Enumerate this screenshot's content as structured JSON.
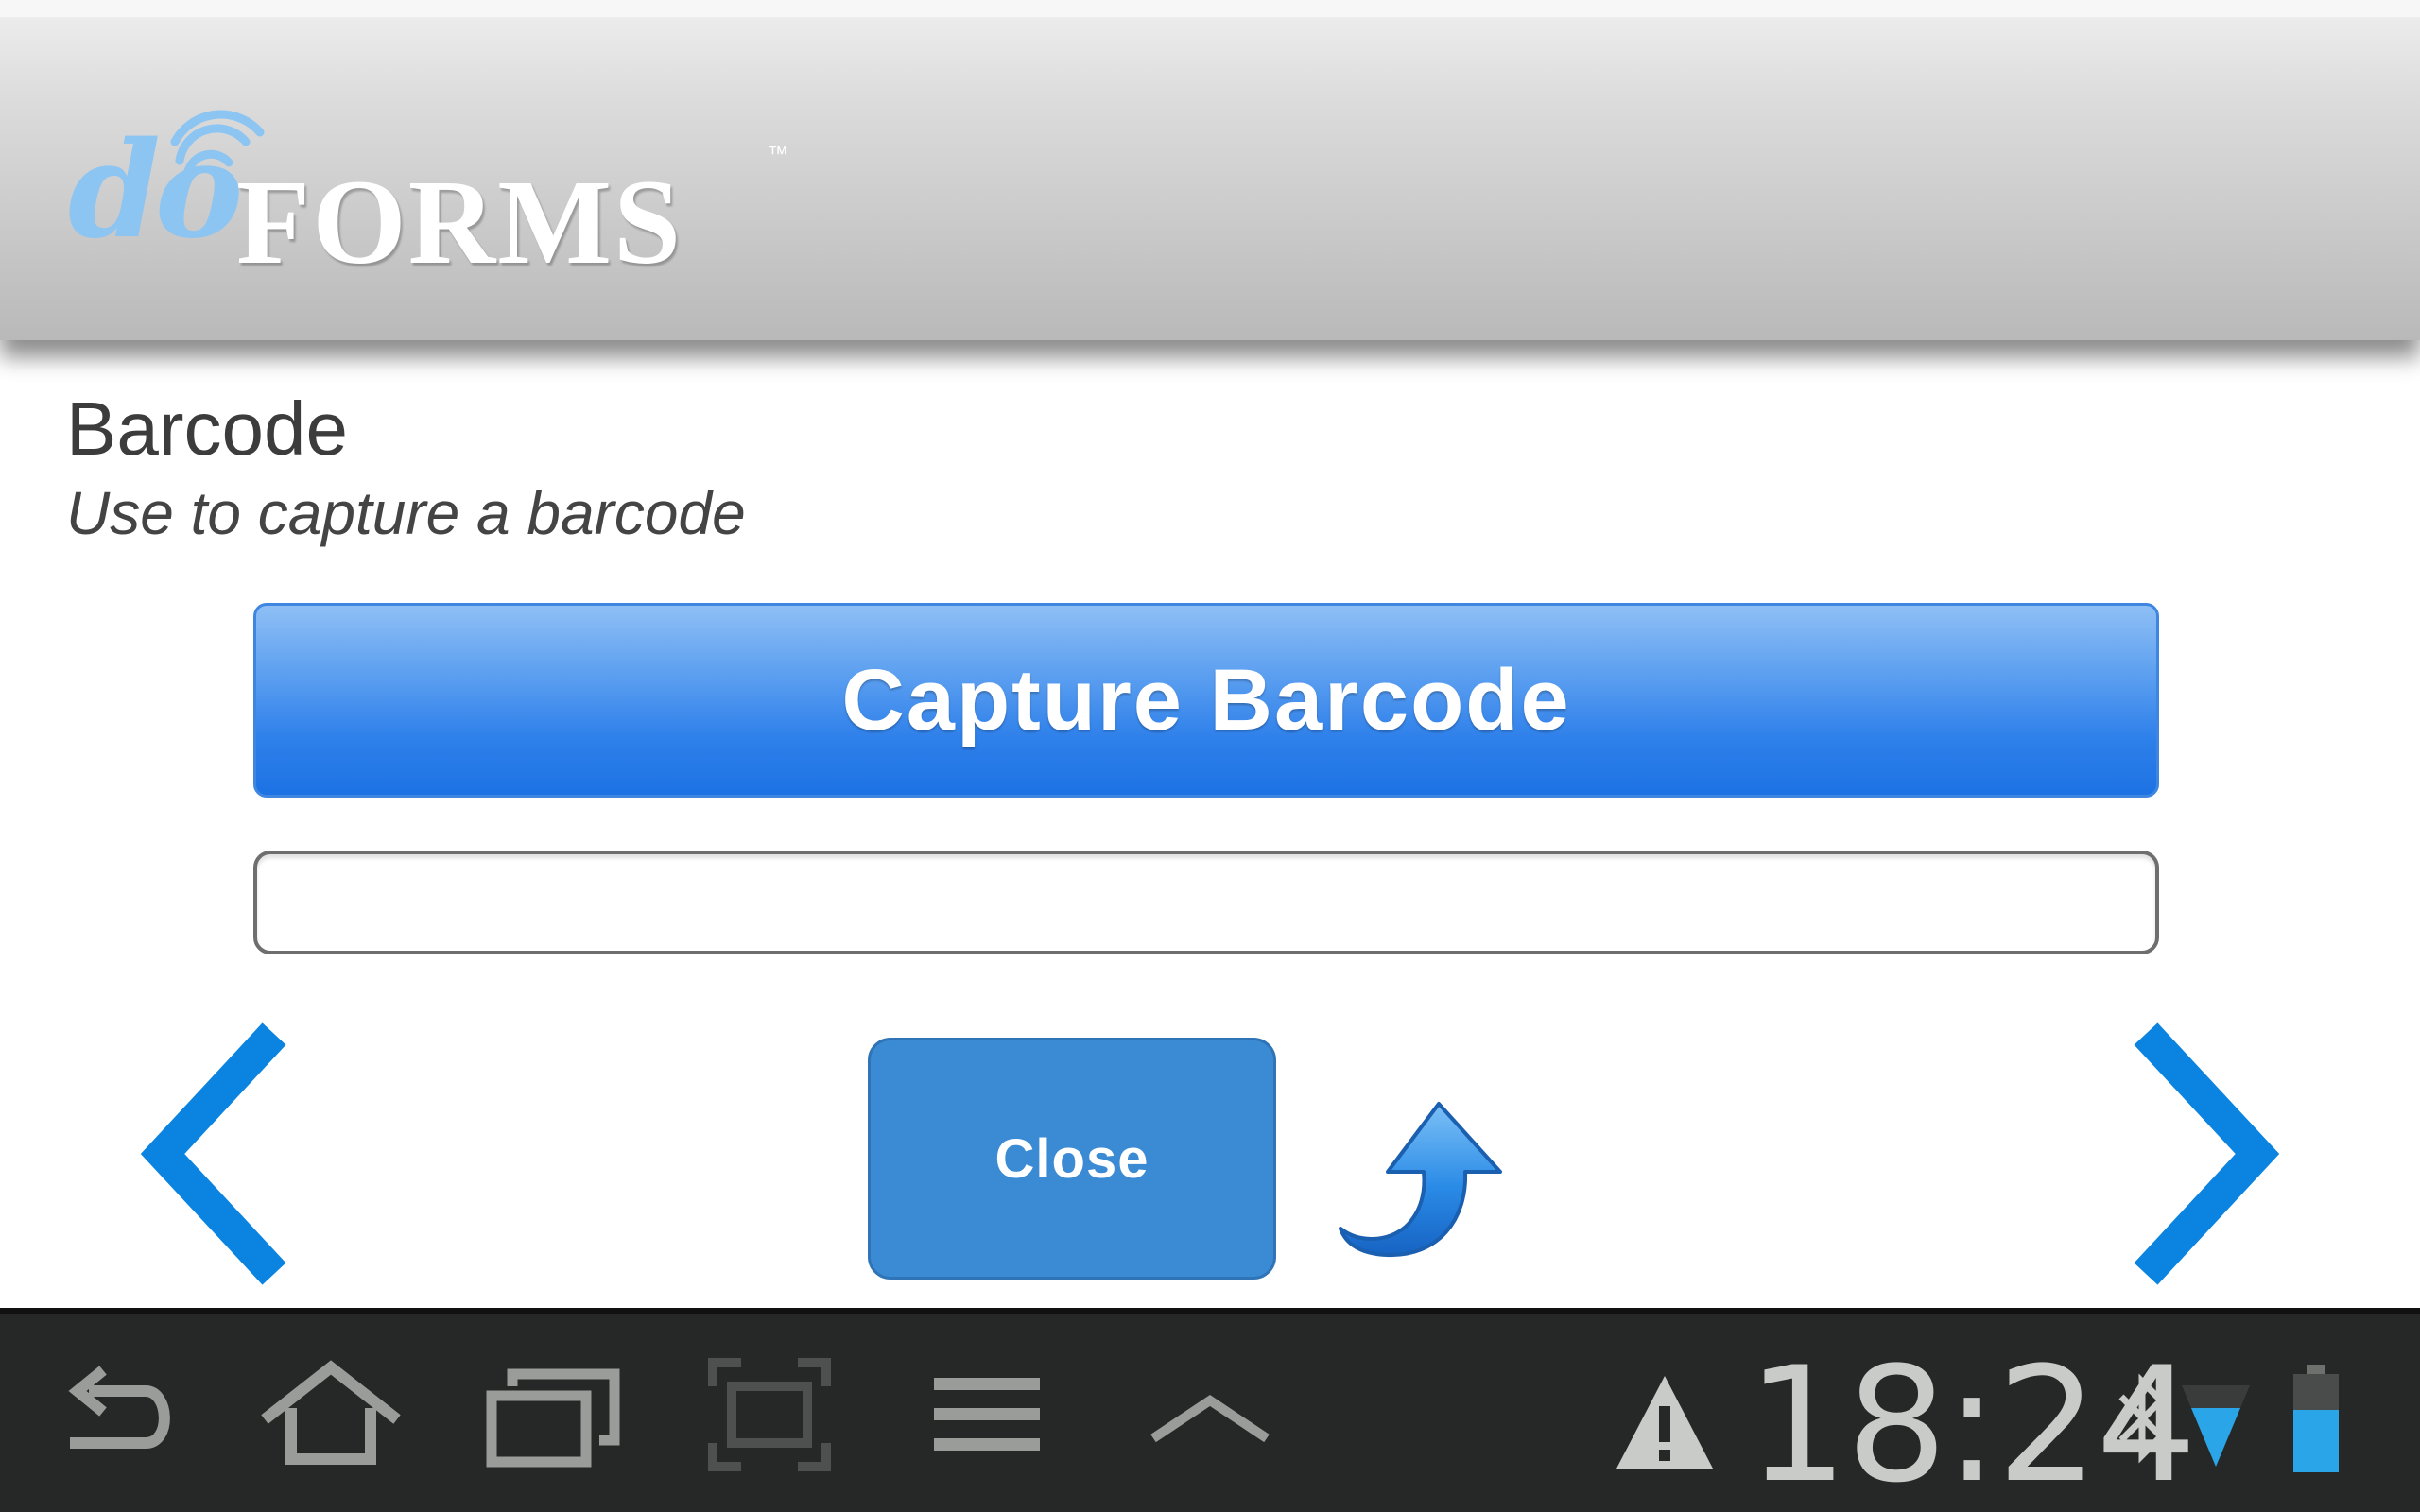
{
  "app": {
    "logo_do": "do",
    "logo_forms": "FORMS",
    "logo_tm": "™"
  },
  "question": {
    "title": "Barcode",
    "hint": "Use to capture a barcode",
    "capture_label": "Capture Barcode",
    "value": ""
  },
  "actions": {
    "close_label": "Close"
  },
  "icons": {
    "prev": "chevron-left-icon",
    "next": "chevron-right-icon",
    "return": "return-arrow-icon",
    "back": "back-icon",
    "home": "home-icon",
    "recent": "recent-apps-icon",
    "screenshot": "screenshot-icon",
    "menu": "menu-icon",
    "up": "chevron-up-icon",
    "warning": "warning-icon",
    "bluetooth": "bluetooth-icon",
    "wifi": "wifi-icon",
    "battery": "battery-icon"
  },
  "colors": {
    "accent": "#1d72e4",
    "nav_arrow": "#0a84e0",
    "close_bg": "#3b8bd4",
    "sysbar_bg": "#262827"
  },
  "status": {
    "time": "18:24"
  }
}
